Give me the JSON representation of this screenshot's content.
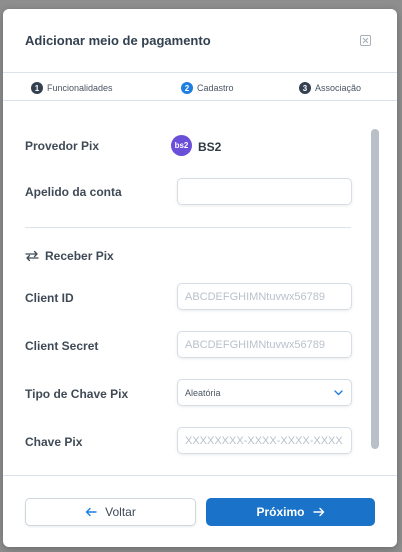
{
  "modal": {
    "title": "Adicionar meio de pagamento"
  },
  "steps": [
    {
      "number": "1",
      "label": "Funcionalidades",
      "active": false
    },
    {
      "number": "2",
      "label": "Cadastro",
      "active": true
    },
    {
      "number": "3",
      "label": "Associação",
      "active": false
    }
  ],
  "form": {
    "provider_label": "Provedor Pix",
    "provider_logo_text": "bs2",
    "provider_name": "BS2",
    "nickname_label": "Apelido da conta",
    "nickname_value": "",
    "section_title": "Receber Pix",
    "client_id_label": "Client ID",
    "client_id_placeholder": "ABCDEFGHIMNtuvwx56789",
    "client_secret_label": "Client Secret",
    "client_secret_placeholder": "ABCDEFGHIMNtuvwx56789",
    "key_type_label": "Tipo de Chave Pix",
    "key_type_value": "Aleatória",
    "key_label": "Chave Pix",
    "key_placeholder": "XXXXXXXX-XXXX-XXXX-XXXX"
  },
  "footer": {
    "back_label": "Voltar",
    "next_label": "Próximo"
  },
  "colors": {
    "primary": "#1a73c9",
    "active_step": "#1e7fe0",
    "provider_logo": "#6a4fd8"
  }
}
